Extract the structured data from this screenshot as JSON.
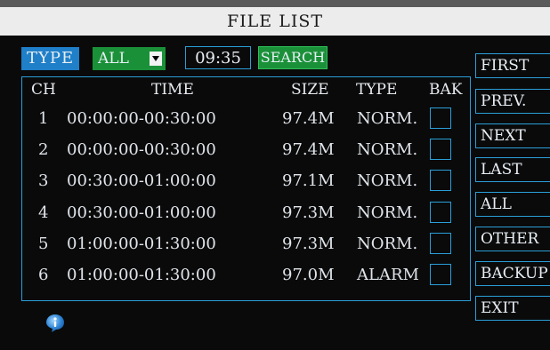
{
  "title": "FILE LIST",
  "filter": {
    "type_label": "TYPE",
    "type_value": "ALL",
    "time_value": "09:35",
    "search_label": "SEARCH"
  },
  "columns": [
    "CH",
    "TIME",
    "SIZE",
    "TYPE",
    "BAK"
  ],
  "rows": [
    {
      "ch": "1",
      "time": "00:00:00-00:30:00",
      "size": "97.4M",
      "type": "NORM."
    },
    {
      "ch": "2",
      "time": "00:00:00-00:30:00",
      "size": "97.4M",
      "type": "NORM."
    },
    {
      "ch": "3",
      "time": "00:30:00-01:00:00",
      "size": "97.1M",
      "type": "NORM."
    },
    {
      "ch": "4",
      "time": "00:30:00-01:00:00",
      "size": "97.3M",
      "type": "NORM."
    },
    {
      "ch": "5",
      "time": "01:00:00-01:30:00",
      "size": "97.3M",
      "type": "NORM."
    },
    {
      "ch": "6",
      "time": "01:00:00-01:30:00",
      "size": "97.0M",
      "type": "ALARM"
    }
  ],
  "side_buttons": [
    "FIRST",
    "PREV.",
    "NEXT",
    "LAST",
    "ALL",
    "OTHER",
    "BACKUP",
    "EXIT"
  ],
  "icons": {
    "info": "info-icon"
  },
  "colors": {
    "accent_blue": "#2a9fd8",
    "accent_green": "#1a9138",
    "type_blue": "#1f7fc8"
  }
}
